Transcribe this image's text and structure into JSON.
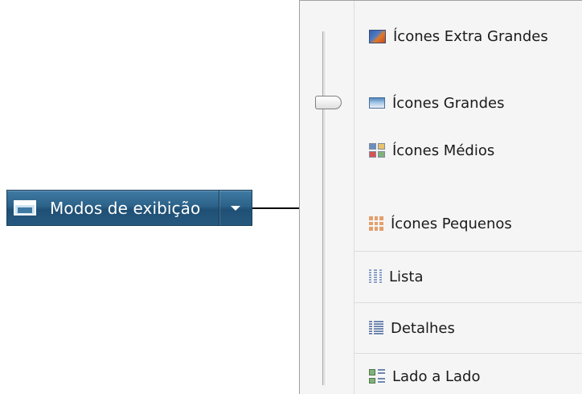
{
  "toolbar": {
    "views_button_label": "Modos de exibição",
    "views_icon": "views-icon",
    "dropdown_icon": "chevron-down-icon",
    "gradient_color": "#2c6289"
  },
  "menu": {
    "slider": {
      "selected_item": "Ícones Grandes"
    },
    "items": [
      {
        "label": "Ícones Extra Grandes",
        "icon": "extra-large-icons-icon"
      },
      {
        "label": "Ícones Grandes",
        "icon": "large-icons-icon"
      },
      {
        "label": "Ícones Médios",
        "icon": "medium-icons-icon"
      },
      {
        "label": "Ícones Pequenos",
        "icon": "small-icons-icon"
      },
      {
        "label": "Lista",
        "icon": "list-icon"
      },
      {
        "label": "Detalhes",
        "icon": "details-icon"
      },
      {
        "label": "Lado a Lado",
        "icon": "tiles-icon"
      }
    ]
  }
}
